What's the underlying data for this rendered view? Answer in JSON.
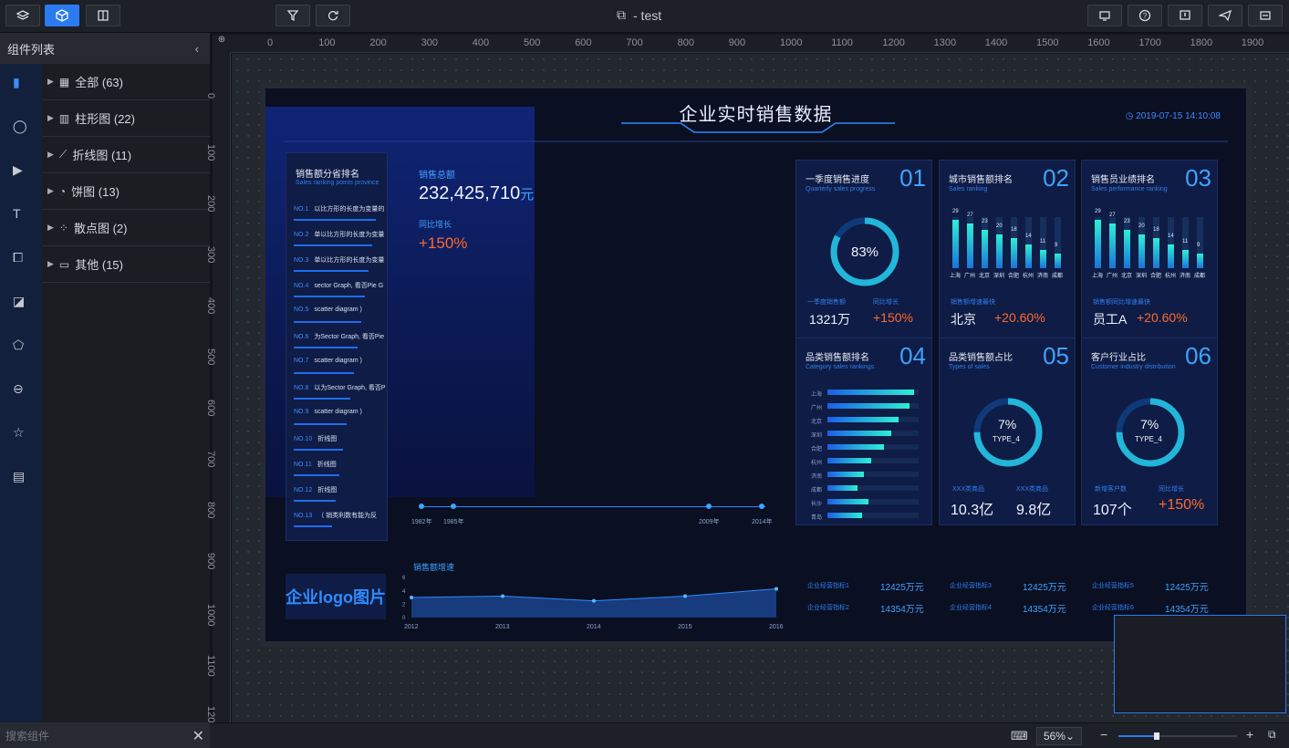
{
  "toolbar": {
    "left_buttons": [
      "layers-icon",
      "cube-icon",
      "split-panel-icon"
    ],
    "mid_buttons": [
      "filter-icon",
      "refresh-icon"
    ],
    "title": "- test",
    "right_buttons": [
      "share-icon",
      "help-icon",
      "alert-icon",
      "send-icon",
      "monitor-icon"
    ]
  },
  "left_panel": {
    "title": "组件列表",
    "collapse": "‹",
    "tree": [
      {
        "label": "全部 (63)",
        "icon": "grid-icon"
      },
      {
        "label": "柱形图 (22)",
        "icon": "bar-chart-icon"
      },
      {
        "label": "折线图 (11)",
        "icon": "line-chart-icon"
      },
      {
        "label": "饼图 (13)",
        "icon": "pie-chart-icon"
      },
      {
        "label": "散点图 (2)",
        "icon": "scatter-icon"
      },
      {
        "label": "其他 (15)",
        "icon": "other-icon"
      }
    ],
    "rail_icons": [
      "bar-icon",
      "map-pin-icon",
      "play-icon",
      "text-icon",
      "frame-icon",
      "shape-icon",
      "polygon-icon",
      "more-icon",
      "star-icon",
      "ellipsis-box-icon"
    ],
    "search_placeholder": "搜索组件",
    "search_clear": "✕"
  },
  "ruler": {
    "h_ticks": [
      "0",
      "100",
      "200",
      "300",
      "400",
      "500",
      "600",
      "700",
      "800",
      "900",
      "1000",
      "1100",
      "1200",
      "1300",
      "1400",
      "1500",
      "1600",
      "1700",
      "1800",
      "1900"
    ],
    "v_ticks": [
      "0",
      "100",
      "200",
      "300",
      "400",
      "500",
      "600",
      "700",
      "800",
      "900",
      "1000",
      "1100",
      "120"
    ]
  },
  "dashboard": {
    "title": "企业实时销售数据",
    "time": "2019-07-15 14:10:08",
    "rank_title": "销售额分省排名",
    "rank_sub": "Sales ranking points province",
    "ranks": [
      {
        "no": "NO.1",
        "t": "以比方形的长度为变量的"
      },
      {
        "no": "NO.2",
        "t": "单以比方形的长度为变量"
      },
      {
        "no": "NO.3",
        "t": "单以比方形的长度为变量"
      },
      {
        "no": "NO.4",
        "t": "sector Graph, 看否Pie G"
      },
      {
        "no": "NO.5",
        "t": "scatter diagram )"
      },
      {
        "no": "NO.6",
        "t": "为Sector Graph, 看否Pie"
      },
      {
        "no": "NO.7",
        "t": "scatter diagram )"
      },
      {
        "no": "NO.8",
        "t": "以为Sector Graph, 看否P"
      },
      {
        "no": "NO.9",
        "t": "scatter diagram )"
      },
      {
        "no": "NO.10",
        "t": "折线图"
      },
      {
        "no": "NO.11",
        "t": "折线图"
      },
      {
        "no": "NO.12",
        "t": "折线图"
      },
      {
        "no": "NO.13",
        "t": "（ 销类利数有能为反"
      }
    ],
    "total_label": "销售总额",
    "total_value": "232,425,710",
    "total_unit": "元",
    "growth_label": "同比增长",
    "growth_value": "+150%",
    "timeline": [
      "1982年",
      "1985年",
      "2009年",
      "2014年"
    ],
    "p01": {
      "t": "一季度销售进度",
      "s": "Quarterly sales progress",
      "n": "01",
      "pct": "83%",
      "k1": "一季度销售额",
      "v1": "1321万",
      "k2": "同比增长",
      "v2": "+150%"
    },
    "p02": {
      "t": "城市销售额排名",
      "s": "Sales ranking",
      "n": "02",
      "k": "销售额增速最快",
      "city": "北京",
      "v": "+20.60%",
      "bars": [
        29,
        27,
        23,
        20,
        18,
        14,
        11,
        9
      ],
      "cats": [
        "上海",
        "广州",
        "北京",
        "深圳",
        "合肥",
        "杭州",
        "济南",
        "成都"
      ]
    },
    "p03": {
      "t": "销售员业绩排名",
      "s": "Sales performance ranking",
      "n": "03",
      "k": "销售额同比增速最快",
      "who": "员工A",
      "v": "+20.60%",
      "bars": [
        29,
        27,
        23,
        20,
        18,
        14,
        11,
        9
      ],
      "cats": [
        "上海",
        "广州",
        "北京",
        "深圳",
        "合肥",
        "杭州",
        "济南",
        "成都"
      ]
    },
    "p04": {
      "t": "品类销售额排名",
      "s": "Category sales rankings",
      "n": "04",
      "cats": [
        "上海",
        "广州",
        "北京",
        "深圳",
        "合肥",
        "杭州",
        "济南",
        "成都",
        "长沙",
        "青岛"
      ],
      "vals": [
        95,
        90,
        78,
        70,
        62,
        48,
        40,
        33,
        45,
        38
      ]
    },
    "p05": {
      "t": "品类销售额占比",
      "s": "Types of sales",
      "n": "05",
      "pct": "7%",
      "type": "TYPE_4",
      "k1": "XXX类商品",
      "v1": "10.3亿",
      "k2": "XXX类商品",
      "v2": "9.8亿"
    },
    "p06": {
      "t": "客户行业占比",
      "s": "Customer industry distribution",
      "n": "06",
      "pct": "7%",
      "type": "TYPE_4",
      "k1": "新增客户数",
      "v1": "107个",
      "k2": "同比增长",
      "v2": "+150%"
    },
    "logo": "企业logo图片",
    "speed_title": "销售额增速",
    "metrics": [
      [
        "企业经营指标1",
        "12425万元"
      ],
      [
        "企业经营指标3",
        "12425万元"
      ],
      [
        "企业经营指标5",
        "12425万元"
      ],
      [
        "企业经营指标2",
        "14354万元"
      ],
      [
        "企业经营指标4",
        "14354万元"
      ],
      [
        "企业经营指标6",
        "14354万元"
      ]
    ]
  },
  "chart_data": [
    {
      "type": "line",
      "title": "销售额增速",
      "x": [
        "2012",
        "2013",
        "2014",
        "2015",
        "2016"
      ],
      "values": [
        3,
        3.2,
        2.5,
        3.2,
        4.3
      ],
      "ylim": [
        0,
        6
      ],
      "yticks": [
        "0",
        "2",
        "4",
        "6"
      ]
    },
    {
      "type": "bar",
      "categories": [
        "上海",
        "广州",
        "北京",
        "深圳",
        "合肥",
        "杭州",
        "济南",
        "成都"
      ],
      "values": [
        29,
        27,
        23,
        20,
        18,
        14,
        11,
        9
      ]
    }
  ],
  "bottom": {
    "zoom": "56%",
    "zoom_pct": 0.32,
    "minus": "−",
    "plus": "+"
  }
}
